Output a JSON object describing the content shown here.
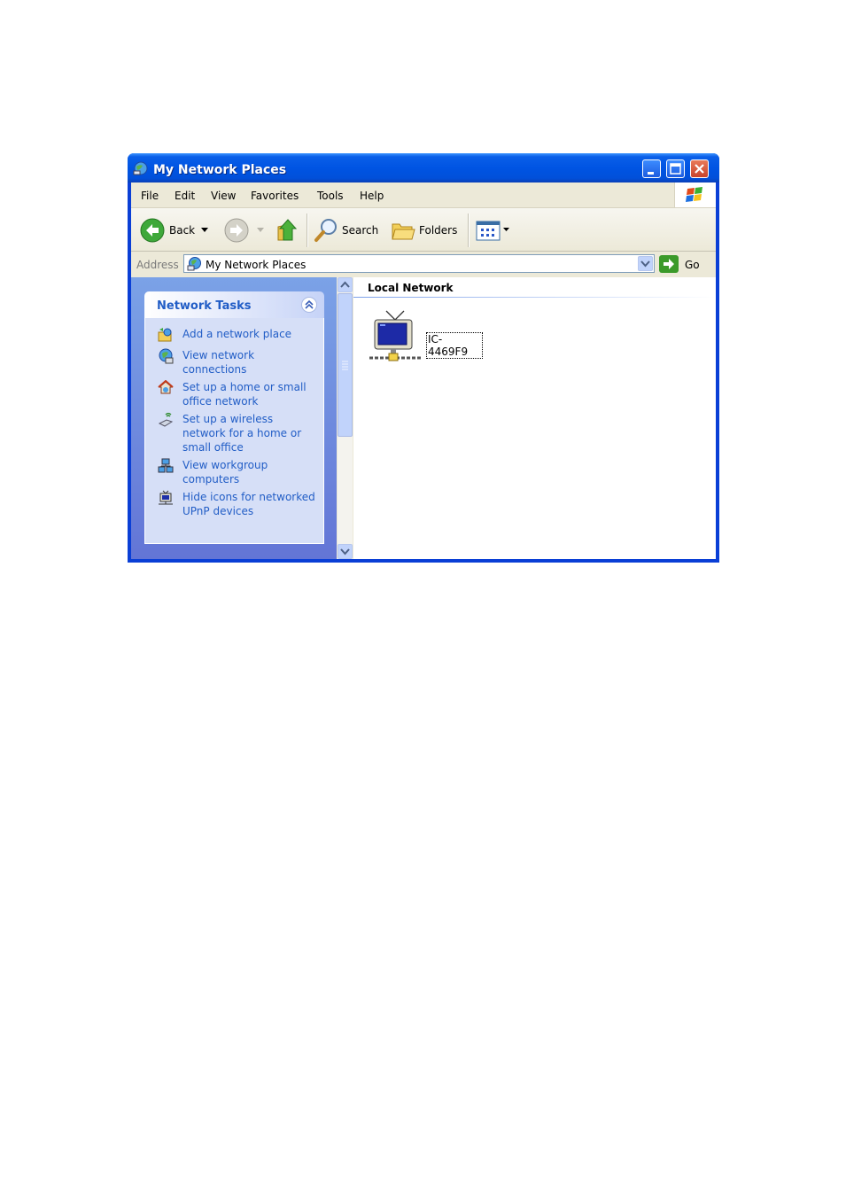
{
  "window": {
    "title": "My Network Places",
    "title_icon": "network-places-icon",
    "controls": [
      "minimize",
      "maximize",
      "close"
    ]
  },
  "menu": {
    "items": [
      "File",
      "Edit",
      "View",
      "Favorites",
      "Tools",
      "Help"
    ]
  },
  "toolbar": {
    "back_label": "Back",
    "search_label": "Search",
    "folders_label": "Folders"
  },
  "address": {
    "label": "Address",
    "value": "My Network Places",
    "go_label": "Go"
  },
  "task_pane": {
    "title": "Network Tasks",
    "tasks": [
      {
        "label": "Add a network place",
        "icon": "add-network-place-icon"
      },
      {
        "label": "View network connections",
        "icon": "network-connections-icon"
      },
      {
        "label": "Set up a home or small office network",
        "icon": "home-network-icon"
      },
      {
        "label": "Set up a wireless network for a home or small office",
        "icon": "wireless-network-icon"
      },
      {
        "label": "View workgroup computers",
        "icon": "workgroup-icon"
      },
      {
        "label": "Hide icons for networked UPnP devices",
        "icon": "upnp-device-icon"
      }
    ]
  },
  "content": {
    "group_title": "Local Network",
    "items": [
      {
        "label": "IC-4469F9",
        "icon": "upnp-tv-device-icon"
      }
    ]
  },
  "colors": {
    "titlebar": "#0054e3",
    "taskpane": "#7ba2e7",
    "task_link": "#215dc6"
  }
}
